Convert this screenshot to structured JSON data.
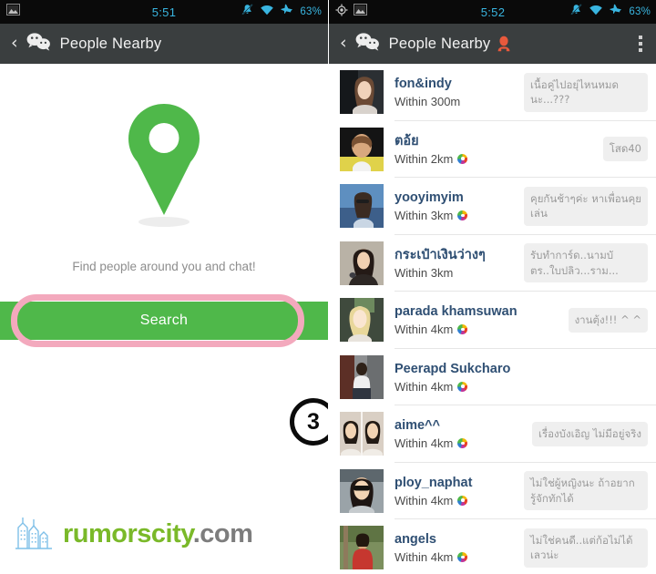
{
  "left": {
    "statusbar": {
      "time": "5:51",
      "battery": "63%",
      "left_icons": [
        "gallery-icon"
      ],
      "right_icons": [
        "mute-bell-icon",
        "wifi-icon",
        "airplane-mode-icon"
      ]
    },
    "actionbar": {
      "back": "‹",
      "title": "People Nearby",
      "logo": "wechat-logo-icon"
    },
    "empty_state": {
      "pin_icon": "map-pin-icon",
      "pin_color": "#4fb84a",
      "hint": "Find people around you and chat!"
    },
    "search_button": {
      "label": "Search",
      "color": "#4fb84a"
    },
    "annotation": {
      "step_number": "3",
      "highlight_color": "#f3a9bd"
    },
    "watermark": {
      "icon": "city-skyline-icon",
      "name": "rumorscity",
      "tld": ".com",
      "name_color": "#7ab929",
      "tld_color": "#7d7d7d"
    }
  },
  "right": {
    "statusbar": {
      "time": "5:52",
      "battery": "63%",
      "left_icons": [
        "gps-location-icon",
        "gallery-icon"
      ],
      "right_icons": [
        "mute-bell-icon",
        "wifi-icon",
        "airplane-mode-icon"
      ]
    },
    "actionbar": {
      "back": "‹",
      "title": "People Nearby",
      "logo": "wechat-logo-icon",
      "person_icon": "person-filter-icon",
      "person_icon_color": "#e8593c",
      "more": "overflow-menu-icon"
    },
    "people": [
      {
        "name": "fon&indy",
        "distance": "Within 300m",
        "has_sights": false,
        "signature": "เนื้อคู่ไปอยุ่ไหนหมดนะ...???",
        "avatar": "woman-in-car-photo"
      },
      {
        "name": "ตอ้ย",
        "distance": "Within 2km",
        "has_sights": true,
        "signature": "โสด40",
        "avatar": "person-yellow-shirt-photo"
      },
      {
        "name": "yooyimyim",
        "distance": "Within 3km",
        "has_sights": true,
        "signature": "คุยกันช้าๆค่ะ หาเพื่อนคุยเล่น",
        "avatar": "woman-sunglasses-photo"
      },
      {
        "name": "กระเป๋าเงินว่างๆ",
        "distance": "Within 3km",
        "has_sights": false,
        "signature": "รับทำการ์ด..นามบั ตร..ใบปลิว...ราม...",
        "avatar": "woman-dark-hair-photo"
      },
      {
        "name": "parada khamsuwan",
        "distance": "Within 4km",
        "has_sights": true,
        "signature": "งานตุ้ง!!! ^ ^",
        "avatar": "blonde-woman-photo"
      },
      {
        "name": "Peerapd Sukcharo",
        "distance": "Within 4km",
        "has_sights": true,
        "signature": "",
        "avatar": "man-working-photo"
      },
      {
        "name": "aime^^",
        "distance": "Within 4km",
        "has_sights": true,
        "signature": "เรื่องบังเอิญ ไม่มีอยู่จริง",
        "avatar": "two-faces-collage-photo"
      },
      {
        "name": "ploy_naphat",
        "distance": "Within 4km",
        "has_sights": true,
        "signature": "ไม่ใช่ผู้หญิงนะ ถ้าอยากรู้จักทักได้",
        "avatar": "woman-black-sunglasses-photo"
      },
      {
        "name": "angels",
        "distance": "Within 4km",
        "has_sights": true,
        "signature": "ไม่ใช่คนดี..แต่ก้อไม่ได้เลวน่ะ",
        "avatar": "woman-red-shirt-photo"
      }
    ]
  }
}
